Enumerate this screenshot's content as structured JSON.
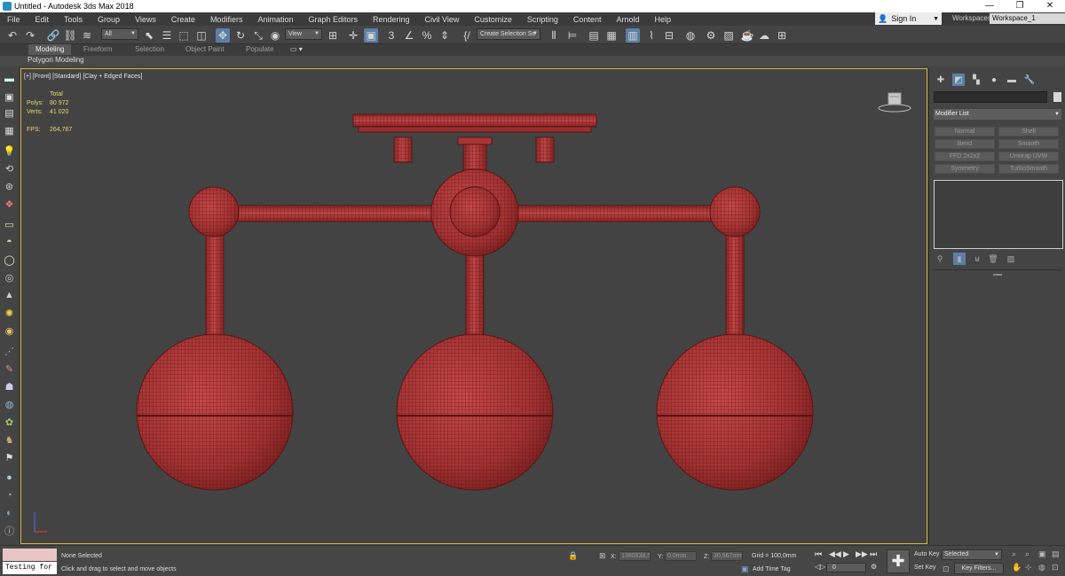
{
  "window": {
    "title": "Untitled - Autodesk 3ds Max 2018",
    "minimize": "—",
    "restore": "❐",
    "close": "✕"
  },
  "menu": {
    "items": [
      "File",
      "Edit",
      "Tools",
      "Group",
      "Views",
      "Create",
      "Modifiers",
      "Animation",
      "Graph Editors",
      "Rendering",
      "Civil View",
      "Customize",
      "Scripting",
      "Content",
      "Arnold",
      "Help"
    ],
    "sign_in": "Sign In",
    "workspaces_label": "Workspaces:",
    "workspace_value": "Workspace_1"
  },
  "toolbar": {
    "filter_value": "All",
    "ref_coord_value": "View",
    "selection_set_value": "Create Selection Se",
    "angle_snap_label": "3",
    "percent_label": "%"
  },
  "ribbon": {
    "tabs": [
      "Modeling",
      "Freeform",
      "Selection",
      "Object Paint",
      "Populate"
    ],
    "active_tab": "Modeling",
    "subpanel": "Polygon Modeling"
  },
  "viewport": {
    "label": "[+] [Front] [Standard] [Clay + Edged Faces]",
    "stats": {
      "total_label": "Total",
      "polys_label": "Polys:",
      "polys_value": "80 972",
      "verts_label": "Verts:",
      "verts_value": "41 020",
      "fps_label": "FPS:",
      "fps_value": "264,767"
    },
    "mesh_color": "#b03a3a",
    "wire_color": "#5a1414",
    "border_color": "#d4b23b"
  },
  "command_panel": {
    "modifier_list": "Modifier List",
    "modifier_buttons": [
      "Normal",
      "Shell",
      "Bend",
      "Smooth",
      "FFD 2x2x2",
      "Unwrap UVW",
      "Symmetry",
      "TurboSmooth"
    ]
  },
  "status": {
    "selection": "None Selected",
    "prompt": "Click and drag to select and move objects",
    "maxscript_value": "Testing for",
    "x_label": "X:",
    "x_value": "1380838,56",
    "y_label": "Y:",
    "y_value": "0,0mm",
    "z_label": "Z:",
    "z_value": "30,567mm",
    "grid": "Grid = 100,0mm",
    "add_time_tag": "Add Time Tag",
    "frame_value": "0",
    "auto_key": "Auto Key",
    "set_key": "Set Key",
    "selected_value": "Selected",
    "key_filters": "Key Filters..."
  }
}
